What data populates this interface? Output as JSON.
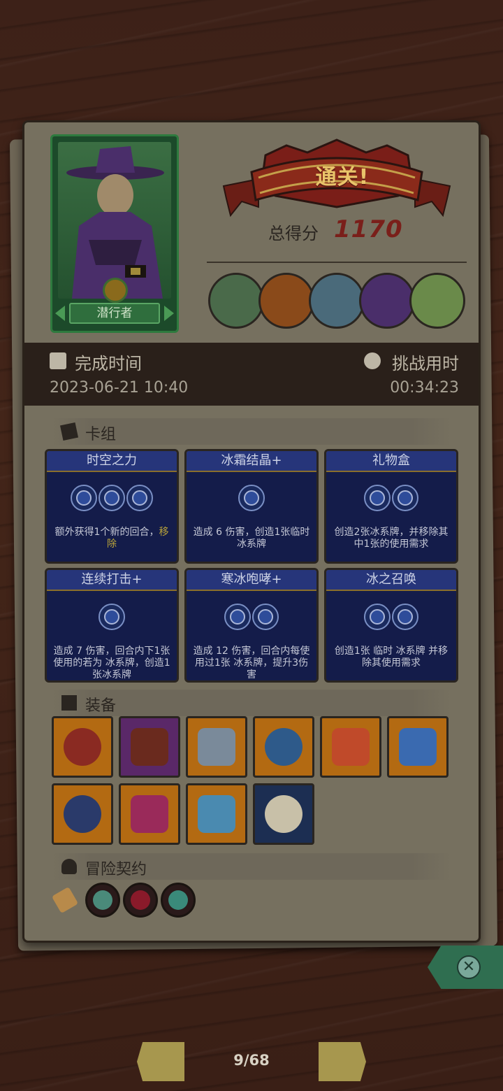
{
  "hero": {
    "name": "潜行者"
  },
  "result": {
    "banner": "通关!",
    "score_label": "总得分",
    "score_value": "1170"
  },
  "times": {
    "finish_label": "完成时间",
    "finish_value": "2023-06-21 10:40",
    "challenge_label": "挑战用时",
    "challenge_value": "00:34:23"
  },
  "sections": {
    "deck": "卡组",
    "equipment": "装备",
    "contract": "冒险契约"
  },
  "cards": [
    {
      "title": "时空之力",
      "costs": 3,
      "desc": "额外获得1个新的回合，",
      "highlight": "移除"
    },
    {
      "title": "冰霜结晶+",
      "costs": 1,
      "desc": "造成 6 伤害，创造1张临时 冰系牌",
      "highlight": ""
    },
    {
      "title": "礼物盒",
      "costs": 2,
      "desc": "创造2张冰系牌，并移除其中1张的使用需求",
      "highlight": ""
    },
    {
      "title": "连续打击+",
      "costs": 1,
      "desc": "造成 7 伤害，回合内下1张使用的若为 冰系牌，创造1张冰系牌",
      "highlight": ""
    },
    {
      "title": "寒冰咆哮+",
      "costs": 2,
      "desc": "造成 12 伤害，回合内每使用过1张 冰系牌，提升3伤害",
      "highlight": ""
    },
    {
      "title": "冰之召唤",
      "costs": 2,
      "desc": "创造1张 临时 冰系牌 并移除其使用需求",
      "highlight": ""
    }
  ],
  "equipment": [
    {
      "name": "spiked-bracelet-icon",
      "tone": "orange",
      "color": "#8a2a22"
    },
    {
      "name": "button-shield-icon",
      "tone": "purple",
      "color": "#6a2a1e"
    },
    {
      "name": "horn-icon",
      "tone": "orange",
      "color": "#7a8a9a"
    },
    {
      "name": "ice-crystal-icon",
      "tone": "orange",
      "color": "#2e5a8a"
    },
    {
      "name": "ring-orb-icon",
      "tone": "orange",
      "color": "#c04a2a"
    },
    {
      "name": "blue-slime-icon",
      "tone": "orange",
      "color": "#3a6ab0"
    },
    {
      "name": "hexagram-icon",
      "tone": "orange",
      "color": "#2a3a6a"
    },
    {
      "name": "pink-orb-icon",
      "tone": "orange",
      "color": "#9a2a5a"
    },
    {
      "name": "ice-die-icon",
      "tone": "orange",
      "color": "#4a8ab0"
    },
    {
      "name": "scroll-icon",
      "tone": "navy",
      "color": "#c8c0a8"
    }
  ],
  "contracts": [
    {
      "name": "scroll-contract-icon",
      "color": "#b88a4a"
    },
    {
      "name": "potion-bottle-icon",
      "color": "#4a8a7a"
    },
    {
      "name": "heart-box-icon",
      "color": "#8a1a2a"
    },
    {
      "name": "jade-ring-icon",
      "color": "#3a8a7a"
    }
  ],
  "pager": {
    "label": "9/68"
  }
}
